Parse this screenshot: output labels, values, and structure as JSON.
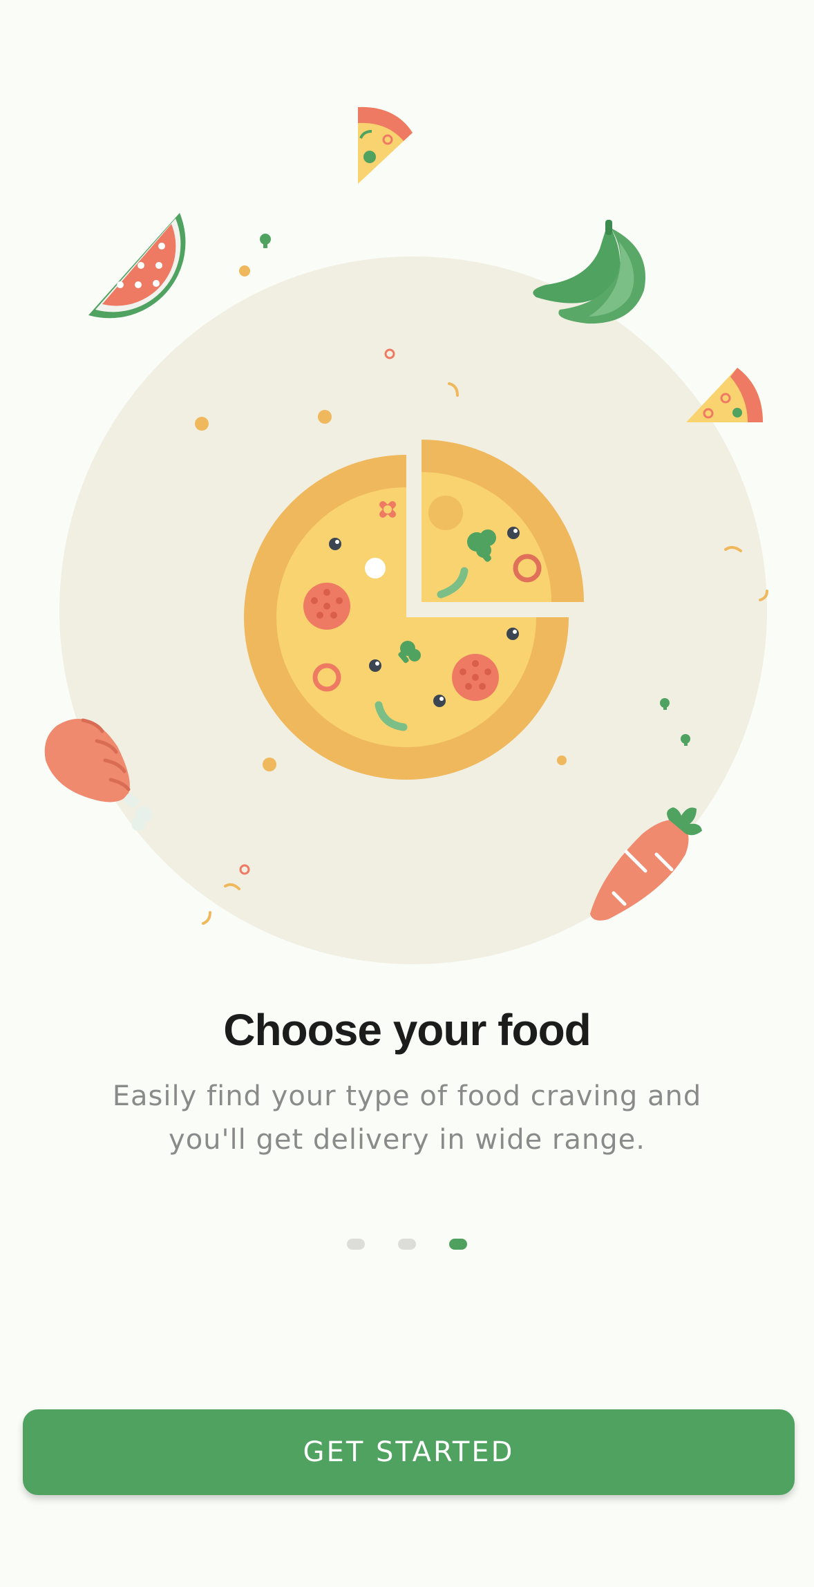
{
  "onboarding": {
    "title": "Choose your food",
    "description": "Easily find your type of food craving and you'll get delivery in wide range.",
    "pager": {
      "total_pages": 3,
      "current_page": 3
    },
    "cta_label": "GET STARTED"
  },
  "theme": {
    "background": "#fafcf8",
    "accent": "#4fa260",
    "circle_backdrop": "#f1efe2",
    "pizza_crust": "#efb85d",
    "pizza_cheese": "#f8d36f",
    "tomato": "#ef7a63",
    "text_primary": "#1c1c1c",
    "text_secondary": "#8a8a8a",
    "dot_inactive": "#dcdcd8"
  },
  "illustration": {
    "items": [
      "pizza-icon",
      "pizza-slice-icon",
      "watermelon-icon",
      "green-chili-icon",
      "chicken-leg-icon",
      "carrot-icon",
      "broccoli-icon",
      "olive-icon",
      "pepperoni-icon"
    ]
  }
}
